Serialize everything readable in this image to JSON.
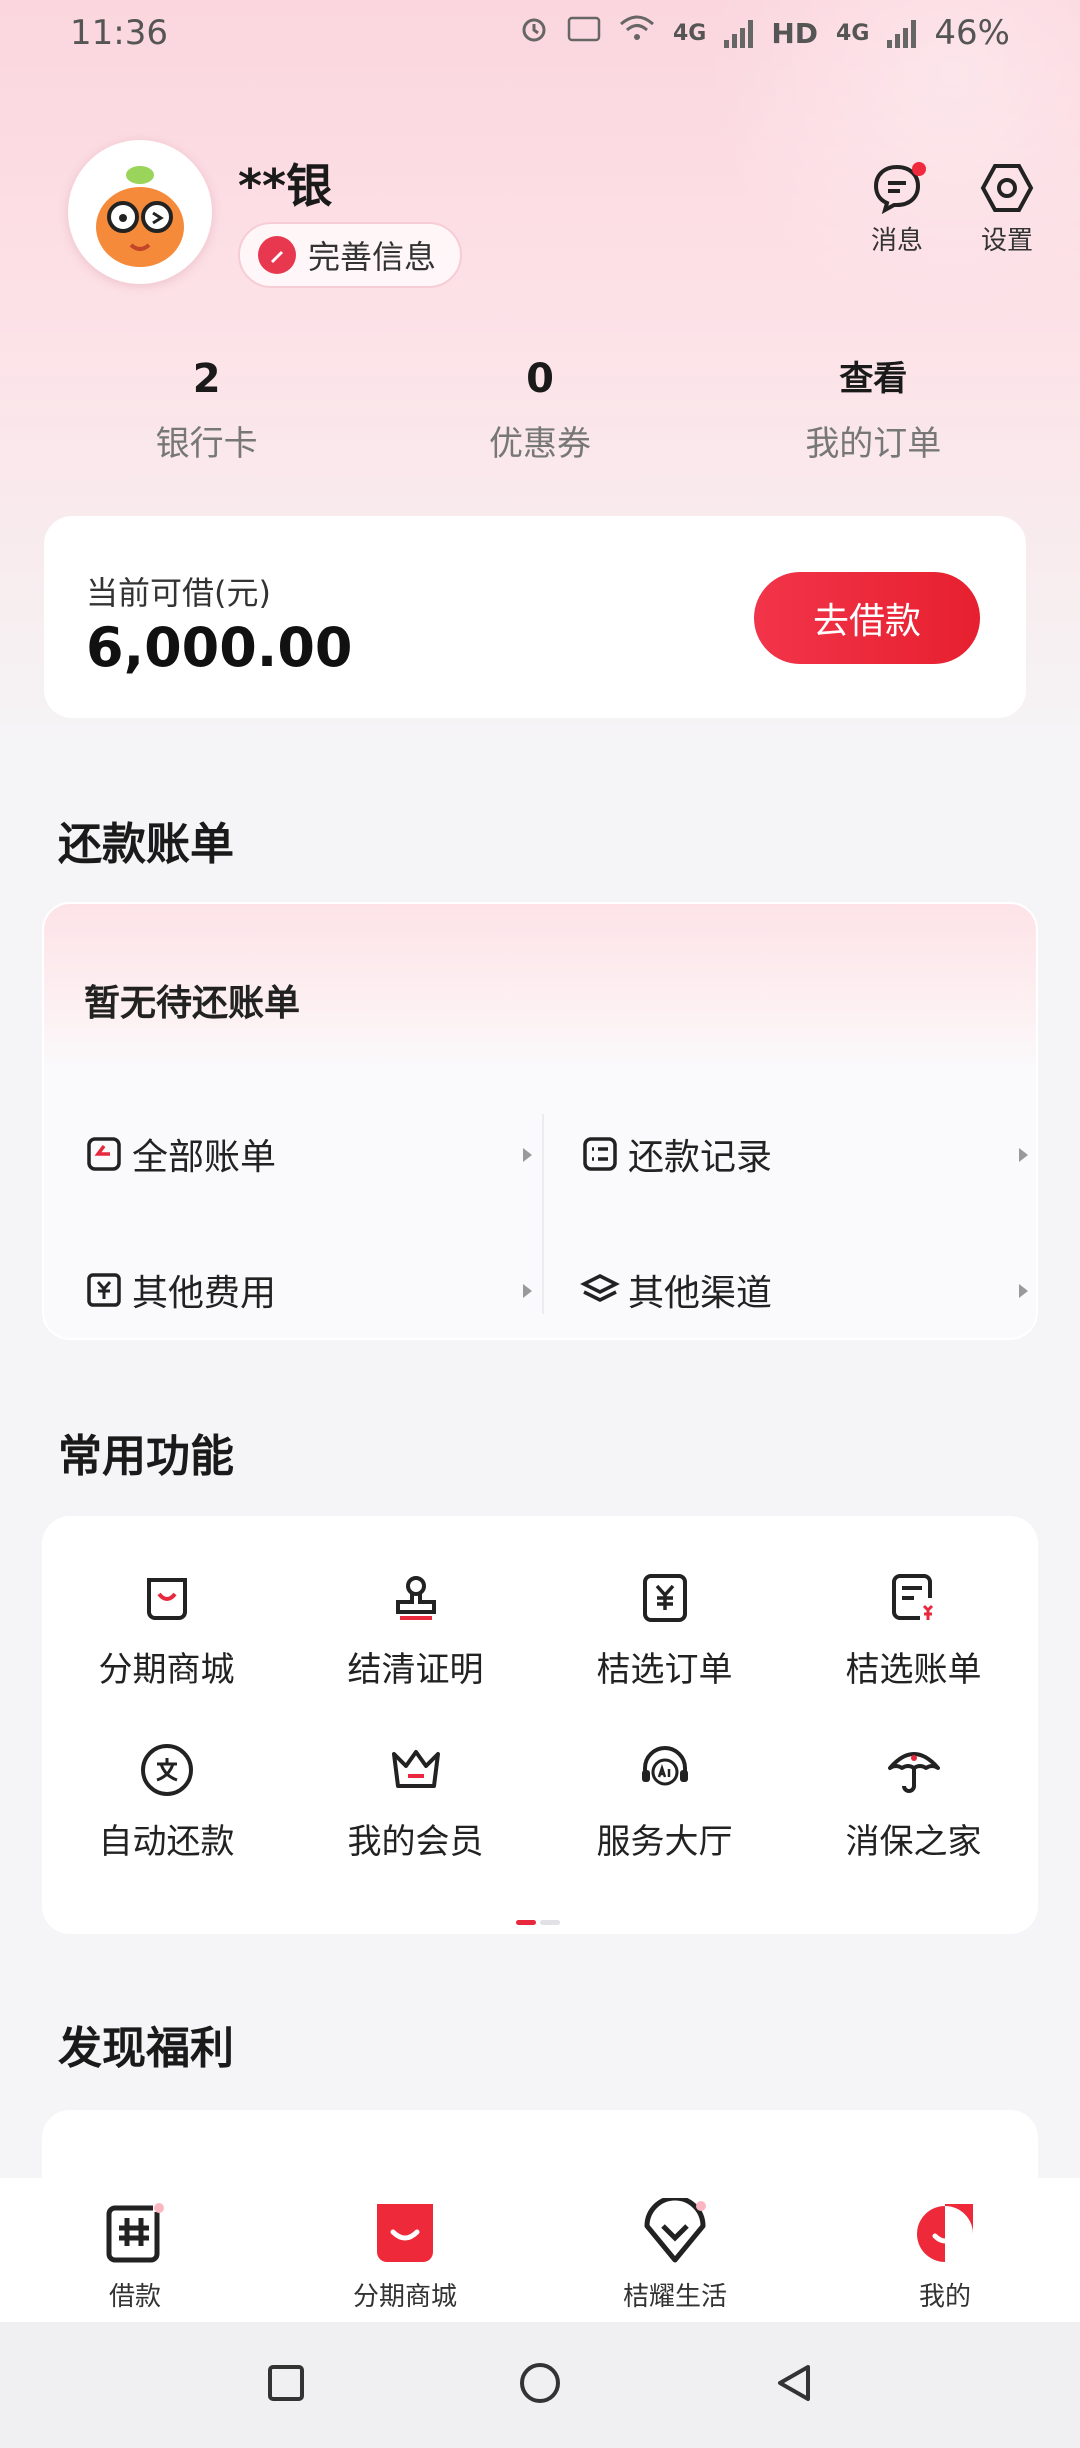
{
  "status_bar": {
    "time": "11:36",
    "network_1": "4G",
    "sim_1": "1",
    "hd": "HD",
    "network_2": "4G",
    "sim_2": "2",
    "battery": "46%"
  },
  "profile": {
    "name": "**银",
    "complete_info_label": "完善信息",
    "messages_label": "消息",
    "settings_label": "设置"
  },
  "stats": [
    {
      "value": "2",
      "label": "银行卡"
    },
    {
      "value": "0",
      "label": "优惠券"
    },
    {
      "value": "查看",
      "label": "我的订单"
    }
  ],
  "loan": {
    "label": "当前可借(元)",
    "amount": "6,000.00",
    "button": "去借款"
  },
  "bills": {
    "title": "还款账单",
    "empty_text": "暂无待还账单",
    "items": [
      {
        "label": "全部账单",
        "icon": "bill-clock-icon"
      },
      {
        "label": "还款记录",
        "icon": "list-icon"
      },
      {
        "label": "其他费用",
        "icon": "yuan-receipt-icon"
      },
      {
        "label": "其他渠道",
        "icon": "layers-icon"
      }
    ]
  },
  "functions": {
    "title": "常用功能",
    "items": [
      {
        "label": "分期商城",
        "icon": "shopping-bag-icon"
      },
      {
        "label": "结清证明",
        "icon": "stamp-icon"
      },
      {
        "label": "桔选订单",
        "icon": "yuan-doc-icon"
      },
      {
        "label": "桔选账单",
        "icon": "bill-doc-icon"
      },
      {
        "label": "自动还款",
        "icon": "alipay-icon"
      },
      {
        "label": "我的会员",
        "icon": "crown-icon"
      },
      {
        "label": "服务大厅",
        "icon": "ai-headset-icon"
      },
      {
        "label": "消保之家",
        "icon": "umbrella-icon"
      }
    ]
  },
  "welfare": {
    "title": "发现福利"
  },
  "tabbar": {
    "items": [
      {
        "label": "借款",
        "icon": "loan-icon"
      },
      {
        "label": "分期商城",
        "icon": "mall-icon"
      },
      {
        "label": "桔耀生活",
        "icon": "life-icon"
      },
      {
        "label": "我的",
        "icon": "mine-icon"
      }
    ]
  },
  "colors": {
    "accent": "#e8283c",
    "header_bg": "#fbd6de",
    "page_bg": "#f5f5f7"
  }
}
